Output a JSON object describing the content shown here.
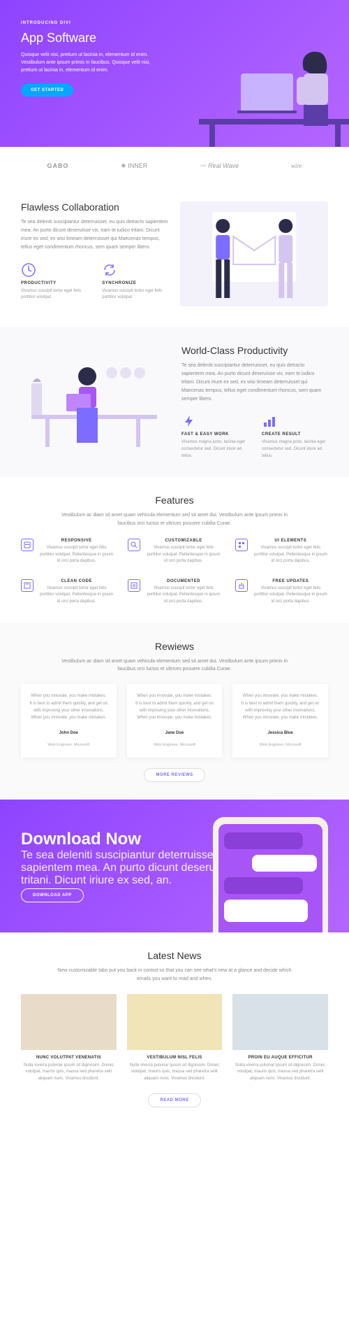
{
  "hero": {
    "kicker": "INTRODUCING DIVI",
    "title": "App Software",
    "body": "Quisque velit nisi, pretium ut lacinia in, elementum id enim. Vestibulum ante ipsum primis in faucibus. Quisque velit nisi, pretium ut lacinia in, elementum id enim.",
    "cta": "GET STARTED"
  },
  "logos": [
    "GABO",
    "INNER",
    "Real Wave",
    "wire"
  ],
  "collab": {
    "title": "Flawless Collaboration",
    "desc": "Te sea deleniti suscipiantur deterruisset, eu quis detracto sapientem mea. An purto dicunt deseruisse vix, eam te iudico tritani. Dicunt iriure ex sed, ex wisi timeam deterruisset qui Maecenas tempus, tellus eget condimentum rhoncus, sem quam semper libero.",
    "items": [
      {
        "title": "PRODUCTIVITY",
        "body": "Vivamus suscipit tortor eget felis porttitor volutpat"
      },
      {
        "title": "SYNCHRONIZE",
        "body": "Vivamus suscipit tortor eget felis porttitor volutpat"
      }
    ]
  },
  "prod": {
    "title": "World-Class Productivity",
    "desc": "Te sea deleniti suscipiantur deterruisset, eu quis detracto sapientem mea. An purto dicunt deseruisse vix, eam te iudico tritani. Dicunt iriure ex sed, ex wisi timeam deterruisset qui Maecenas tempus, tellus eget condimentum rhoncus, sem quam semper libero.",
    "items": [
      {
        "title": "FAST & EASY WORK",
        "body": "Vivamus magna justo, lacinia eget consectetur sed. Dicunt iriure ad tellus."
      },
      {
        "title": "CREATE RESULT",
        "body": "Vivamus magna justo, lacinia eget consectetur sed. Dicunt iriure ad tellus."
      }
    ]
  },
  "features": {
    "title": "Features",
    "desc": "Vestibulum ac diam sit amet quam vehicula elementum sed sit amet dui. Vestibulum ante ipsum primis in faucibus orci luctus et ultrices posuere cubilia Curae.",
    "items": [
      {
        "title": "RESPONSIVE",
        "body": "Vivamus suscipit tortor eget felis porttitor volutpat. Pellentesque in ipsum id orci porta dapibus."
      },
      {
        "title": "CUSTOMIZABLE",
        "body": "Vivamus suscipit tortor eget felis porttitor volutpat. Pellentesque in ipsum id orci porta dapibus."
      },
      {
        "title": "UI ELEMENTS",
        "body": "Vivamus suscipit tortor eget felis porttitor volutpat. Pellentesque in ipsum id orci porta dapibus."
      },
      {
        "title": "CLEAN CODE",
        "body": "Vivamus suscipit tortor eget felis porttitor volutpat. Pellentesque in ipsum id orci porta dapibus."
      },
      {
        "title": "DOCUMENTED",
        "body": "Vivamus suscipit tortor eget felis porttitor volutpat. Pellentesque in ipsum id orci porta dapibus."
      },
      {
        "title": "FREE UPDATES",
        "body": "Vivamus suscipit tortor eget felis porttitor volutpat. Pellentesque in ipsum id orci porta dapibus."
      }
    ]
  },
  "reviews": {
    "title": "Rewiews",
    "desc": "Vestibulum ac diam sit amet quam vehicula elementum sed sit amet dui. Vestibulum ante ipsum primis in faucibus orci luctus et ultrices posuere cubilia Curae.",
    "items": [
      {
        "body": "When you innovate, you make mistakes. It is best to admit them quickly, and get on with improving your other innovations. When you innovate, you make mistakes.",
        "name": "John Doe",
        "role": "Web Engineer, Microsoft"
      },
      {
        "body": "When you innovate, you make mistakes. It is best to admit them quickly, and get on with improving your other innovations. When you innovate, you make mistakes.",
        "name": "Jane Doe",
        "role": "Web Engineer, Microsoft"
      },
      {
        "body": "When you innovate, you make mistakes. It is best to admit them quickly, and get on with improving your other innovations. When you innovate, you make mistakes.",
        "name": "Jessica Blue",
        "role": "Web Engineer, Microsoft"
      }
    ],
    "cta": "MORE REVIEWS"
  },
  "download": {
    "title": "Download Now",
    "desc": "Te sea deleniti suscipiantur deterruisset, eu quis detracto sapientem mea. An purto dicunt deseruisse vix, eam te iudico tritani. Dicunt iriure ex sed, an.",
    "cta": "DOWNLOAD APP"
  },
  "news": {
    "title": "Latest News",
    "desc": "New customizable tabs put you back in control so that you can see what's new at a glance and decide which emails you want to read and when.",
    "items": [
      {
        "title": "NUNC VOLUTPAT VENENATIS",
        "body": "Nulla viverra pulvinar ipsum sit dignissim. Donec volutpat, mauris quis, massa sed pharetra velit aliquam nunc. Vivamus tincidunt."
      },
      {
        "title": "VESTIBULUM NISL FELIS",
        "body": "Nulla viverra pulvinar ipsum sit dignissim. Donec volutpat, mauris quis, massa sed pharetra velit aliquam nunc. Vivamus tincidunt."
      },
      {
        "title": "PROIN EU AUQUE EFFICITUR",
        "body": "Nulla viverra pulvinar ipsum sit dignissim. Donec volutpat, mauris quis, massa sed pharetra velit aliquam nunc. Vivamus tincidunt."
      }
    ],
    "cta": "READ MORE"
  }
}
